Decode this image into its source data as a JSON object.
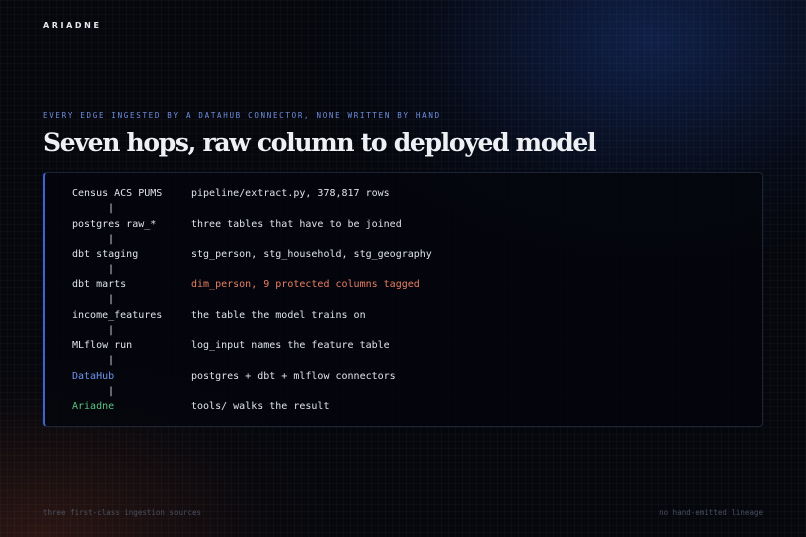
{
  "brand": "ARIADNE",
  "eyebrow": "EVERY EDGE INGESTED BY A DATAHUB CONNECTOR, NONE WRITTEN BY HAND",
  "title": "Seven hops, raw column to deployed model",
  "colors": {
    "accent_blue": "#6d93ec",
    "accent_green": "#59c585",
    "highlight": "#ea7e64",
    "panel_border": "#3d63d2"
  },
  "lineage": {
    "separator": "|",
    "rows": [
      {
        "name": "Census ACS PUMS",
        "desc": "pipeline/extract.py, 378,817 rows"
      },
      {
        "name": "postgres raw_*",
        "desc": "three tables that have to be joined"
      },
      {
        "name": "dbt staging",
        "desc": "stg_person, stg_household, stg_geography"
      },
      {
        "name": "dbt marts",
        "desc": "dim_person, 9 protected columns tagged"
      },
      {
        "name": "income_features",
        "desc": "the table the model trains on"
      },
      {
        "name": "MLflow run",
        "desc": "log_input names the feature table"
      },
      {
        "name": "DataHub",
        "desc": "postgres + dbt + mlflow connectors"
      },
      {
        "name": "Ariadne",
        "desc": "tools/ walks the result"
      }
    ]
  },
  "footer": {
    "left": "three first-class ingestion sources",
    "right": "no hand-emitted lineage"
  }
}
